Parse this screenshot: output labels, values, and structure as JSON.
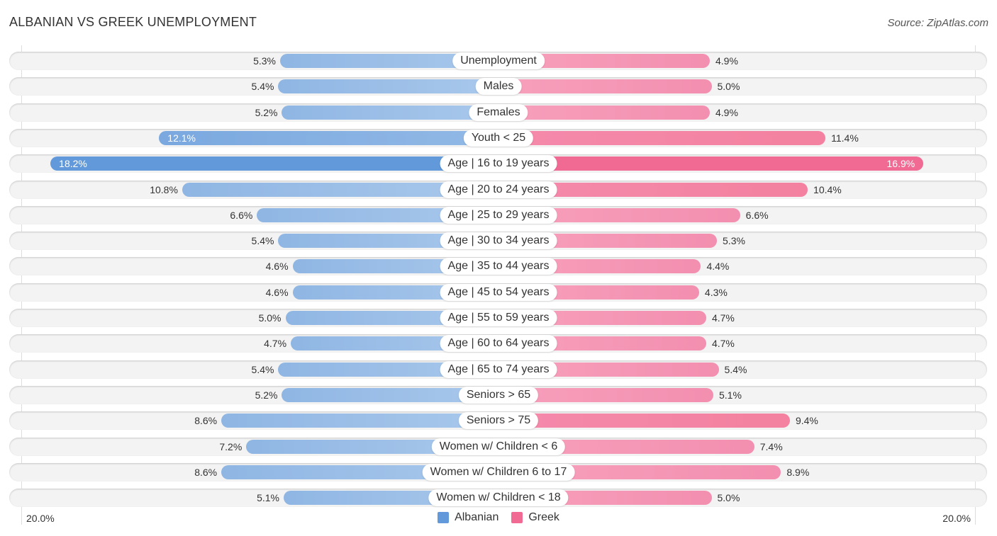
{
  "title": "ALBANIAN VS GREEK UNEMPLOYMENT",
  "source": "Source: ZipAtlas.com",
  "colors": {
    "albanian": "#6199da",
    "greek": "#f06a94"
  },
  "chart_data": {
    "type": "bar",
    "orientation": "horizontal-diverging",
    "title": "ALBANIAN VS GREEK UNEMPLOYMENT",
    "xlim": [
      -20.0,
      20.0
    ],
    "axis_labels": {
      "left": "20.0%",
      "right": "20.0%"
    },
    "legend": [
      "Albanian",
      "Greek"
    ],
    "legend_position": "bottom-center",
    "categories": [
      "Unemployment",
      "Males",
      "Females",
      "Youth < 25",
      "Age | 16 to 19 years",
      "Age | 20 to 24 years",
      "Age | 25 to 29 years",
      "Age | 30 to 34 years",
      "Age | 35 to 44 years",
      "Age | 45 to 54 years",
      "Age | 55 to 59 years",
      "Age | 60 to 64 years",
      "Age | 65 to 74 years",
      "Seniors > 65",
      "Seniors > 75",
      "Women w/ Children < 6",
      "Women w/ Children 6 to 17",
      "Women w/ Children < 18"
    ],
    "series": [
      {
        "name": "Albanian",
        "values": [
          5.3,
          5.4,
          5.2,
          12.1,
          18.2,
          10.8,
          6.6,
          5.4,
          4.6,
          4.6,
          5.0,
          4.7,
          5.4,
          5.2,
          8.6,
          7.2,
          8.6,
          5.1
        ],
        "labels": [
          "5.3%",
          "5.4%",
          "5.2%",
          "12.1%",
          "18.2%",
          "10.8%",
          "6.6%",
          "5.4%",
          "4.6%",
          "4.6%",
          "5.0%",
          "4.7%",
          "5.4%",
          "5.2%",
          "8.6%",
          "7.2%",
          "8.6%",
          "5.1%"
        ]
      },
      {
        "name": "Greek",
        "values": [
          4.9,
          5.0,
          4.9,
          11.4,
          16.9,
          10.4,
          6.6,
          5.3,
          4.4,
          4.3,
          4.7,
          4.7,
          5.4,
          5.1,
          9.4,
          7.4,
          8.9,
          5.0
        ],
        "labels": [
          "4.9%",
          "5.0%",
          "4.9%",
          "11.4%",
          "16.9%",
          "10.4%",
          "6.6%",
          "5.3%",
          "4.4%",
          "4.3%",
          "4.7%",
          "4.7%",
          "5.4%",
          "5.1%",
          "9.4%",
          "7.4%",
          "8.9%",
          "5.0%"
        ]
      }
    ]
  }
}
